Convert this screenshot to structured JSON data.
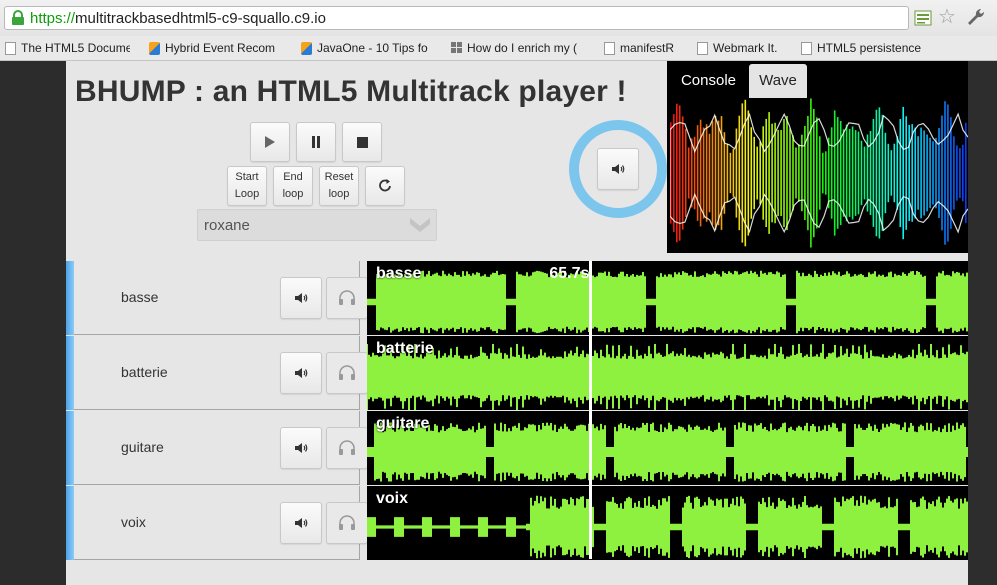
{
  "browser": {
    "url_protocol": "https://",
    "url_host": "multitrackbasedhtml5-c9-squallo.c9.io",
    "bookmarks": [
      {
        "label": "The HTML5 Documen",
        "icon": "document-icon"
      },
      {
        "label": "Hybrid Event Recom",
        "icon": "favicon-icon"
      },
      {
        "label": "JavaOne - 10 Tips fo",
        "icon": "favicon-icon"
      },
      {
        "label": "How do I enrich my (",
        "icon": "grid-icon"
      },
      {
        "label": "manifestR",
        "icon": "document-icon"
      },
      {
        "label": "Webmark It.",
        "icon": "document-icon"
      },
      {
        "label": "HTML5 persistence",
        "icon": "document-icon"
      }
    ]
  },
  "app": {
    "title": "BHUMP : an HTML5 Multitrack player !",
    "transport": {
      "play_icon": "play-icon",
      "pause_icon": "pause-icon",
      "stop_icon": "stop-icon",
      "start_loop": [
        "Start",
        "Loop"
      ],
      "end_loop": [
        "End",
        "loop"
      ],
      "reset_loop": [
        "Reset",
        "loop"
      ],
      "reload_icon": "reload-icon"
    },
    "song_select": {
      "value": "roxane"
    },
    "master_volume_icon": "speaker-icon",
    "panel": {
      "tabs": [
        {
          "label": "Console"
        },
        {
          "label": "Wave"
        }
      ],
      "active_tab": "Wave"
    },
    "current_time": "65.7s",
    "playback_progress": 0.37,
    "tracks": [
      {
        "name": "basse",
        "label": "basse"
      },
      {
        "name": "batterie",
        "label": "batterie"
      },
      {
        "name": "guitare",
        "label": "guitare"
      },
      {
        "name": "voix",
        "label": "voix"
      }
    ],
    "colors": {
      "waveform": "#8ef03f",
      "volume_ring": "#7cc6ee",
      "track_marker": "#4aa3e8"
    }
  }
}
